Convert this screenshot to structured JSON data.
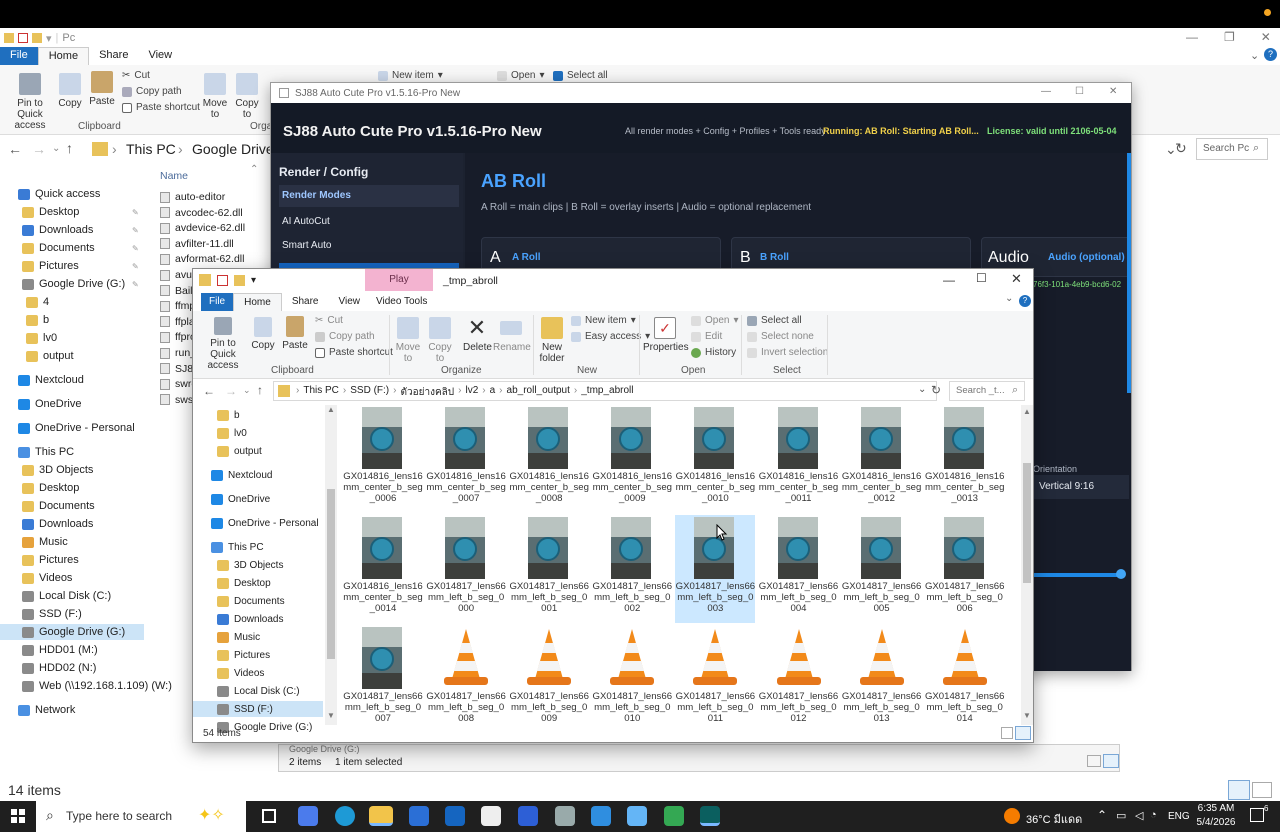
{
  "back_window": {
    "title": "Pc",
    "tabs": [
      "File",
      "Home",
      "Share",
      "View"
    ],
    "clipboard": {
      "pin": "Pin to Quick access",
      "copy": "Copy",
      "paste": "Paste",
      "cut": "Cut",
      "copy_path": "Copy path",
      "paste_shortcut": "Paste shortcut",
      "group": "Clipboard"
    },
    "organize": {
      "move": "Move to",
      "copy": "Copy to",
      "group": "Orga"
    },
    "new_item": "New item",
    "open": "Open",
    "select_all": "Select all",
    "breadcrumb": [
      "This PC",
      "Google Drive"
    ],
    "search_placeholder": "Search Pc",
    "column_name": "Name",
    "nav": [
      {
        "label": "Quick access",
        "icon": "star-icon"
      },
      {
        "label": "Desktop",
        "icon": "folder-icon",
        "pin": true
      },
      {
        "label": "Downloads",
        "icon": "download-icon",
        "pin": true
      },
      {
        "label": "Documents",
        "icon": "folder-icon",
        "pin": true
      },
      {
        "label": "Pictures",
        "icon": "folder-icon",
        "pin": true
      },
      {
        "label": "Google Drive (G:)",
        "icon": "drive-icon",
        "pin": true
      },
      {
        "label": "4",
        "icon": "folder-icon"
      },
      {
        "label": "b",
        "icon": "folder-icon"
      },
      {
        "label": "lv0",
        "icon": "folder-icon"
      },
      {
        "label": "output",
        "icon": "folder-icon"
      },
      {
        "label": "Nextcloud",
        "icon": "cloud-icon"
      },
      {
        "label": "OneDrive",
        "icon": "cloud-icon"
      },
      {
        "label": "OneDrive - Personal",
        "icon": "cloud-icon"
      },
      {
        "label": "This PC",
        "icon": "pc-icon"
      },
      {
        "label": "3D Objects",
        "icon": "folder-icon"
      },
      {
        "label": "Desktop",
        "icon": "folder-icon"
      },
      {
        "label": "Documents",
        "icon": "folder-icon"
      },
      {
        "label": "Downloads",
        "icon": "download-icon"
      },
      {
        "label": "Music",
        "icon": "music-icon"
      },
      {
        "label": "Pictures",
        "icon": "folder-icon"
      },
      {
        "label": "Videos",
        "icon": "folder-icon"
      },
      {
        "label": "Local Disk (C:)",
        "icon": "drive-icon"
      },
      {
        "label": "SSD (F:)",
        "icon": "drive-icon"
      },
      {
        "label": "Google Drive (G:)",
        "icon": "drive-icon",
        "selected": true
      },
      {
        "label": "HDD01 (M:)",
        "icon": "drive-icon"
      },
      {
        "label": "HDD02 (N:)",
        "icon": "drive-icon"
      },
      {
        "label": "Web (\\\\192.168.1.109) (W:)",
        "icon": "drive-icon"
      },
      {
        "label": "Network",
        "icon": "network-icon"
      }
    ],
    "files": [
      "auto-editor",
      "avcodec-62.dll",
      "avdevice-62.dll",
      "avfilter-11.dll",
      "avformat-62.dll",
      "avut",
      "Bail",
      "ffmp",
      "ffpla",
      "ffpro",
      "run_",
      "SJ88",
      "swre",
      "swsc"
    ],
    "status": "14 items"
  },
  "app": {
    "window_title": "SJ88 Auto Cute Pro v1.5.16-Pro New",
    "header_title": "SJ88 Auto Cute Pro v1.5.16-Pro New",
    "header_info": "All render modes + Config + Profiles + Tools ready",
    "header_running": "Running: AB Roll: Starting AB Roll...",
    "header_license": "License: valid until 2106-05-04",
    "side_title": "Render / Config",
    "side_items": [
      "Render Modes",
      "AI AutoCut",
      "Smart Auto"
    ],
    "main_title": "AB Roll",
    "main_subtitle": "A Roll = main clips | B Roll = overlay inserts | Audio = optional replacement",
    "card_a_letter": "A",
    "card_a_label": "A Roll",
    "card_b_letter": "B",
    "card_b_label": "B Roll",
    "card_audio_letter": "Audio",
    "card_audio_label": "Audio (optional)",
    "card_audio_id": "76f3-101a-4eb9-bcd6-02",
    "orientation_label": "Orientation",
    "orientation_value": "Vertical 9:16",
    "status_left": "2 items",
    "status_sel": "1 item selected",
    "nav_partial": "Google Drive (G:)",
    "slider_fraction": 1.0
  },
  "front_window": {
    "context_tab": "Play",
    "title": "_tmp_abroll",
    "tabs": [
      "File",
      "Home",
      "Share",
      "View",
      "Video Tools"
    ],
    "clipboard": {
      "pin": "Pin to Quick access",
      "copy": "Copy",
      "paste": "Paste",
      "cut": "Cut",
      "copy_path": "Copy path",
      "paste_shortcut": "Paste shortcut",
      "group": "Clipboard"
    },
    "organize": {
      "move": "Move to",
      "copy": "Copy to",
      "delete": "Delete",
      "rename": "Rename",
      "group": "Organize"
    },
    "new": {
      "new_folder": "New folder",
      "new_item": "New item",
      "easy_access": "Easy access",
      "group": "New"
    },
    "open": {
      "properties": "Properties",
      "open": "Open",
      "edit": "Edit",
      "history": "History",
      "group": "Open"
    },
    "select": {
      "select_all": "Select all",
      "select_none": "Select none",
      "invert": "Invert selection",
      "group": "Select"
    },
    "breadcrumb": [
      "This PC",
      "SSD (F:)",
      "ตัวอย่างคลิป",
      "lv2",
      "a",
      "ab_roll_output",
      "_tmp_abroll"
    ],
    "search_placeholder": "Search _t...",
    "tree": [
      {
        "label": "b",
        "icon": "folder-icon"
      },
      {
        "label": "lv0",
        "icon": "folder-icon"
      },
      {
        "label": "output",
        "icon": "folder-icon"
      },
      {
        "label": "Nextcloud",
        "icon": "cloud-icon"
      },
      {
        "label": "OneDrive",
        "icon": "cloud-icon"
      },
      {
        "label": "OneDrive - Personal",
        "icon": "cloud-icon"
      },
      {
        "label": "This PC",
        "icon": "pc-icon"
      },
      {
        "label": "3D Objects",
        "icon": "folder-icon"
      },
      {
        "label": "Desktop",
        "icon": "folder-icon"
      },
      {
        "label": "Documents",
        "icon": "folder-icon"
      },
      {
        "label": "Downloads",
        "icon": "download-icon"
      },
      {
        "label": "Music",
        "icon": "music-icon"
      },
      {
        "label": "Pictures",
        "icon": "folder-icon"
      },
      {
        "label": "Videos",
        "icon": "folder-icon"
      },
      {
        "label": "Local Disk (C:)",
        "icon": "drive-icon"
      },
      {
        "label": "SSD (F:)",
        "icon": "drive-icon",
        "selected": true
      },
      {
        "label": "Google Drive (G:)",
        "icon": "drive-icon"
      }
    ],
    "files": [
      {
        "name": "GX014816_lens16mm_center_b_seg_0006",
        "kind": "thumb"
      },
      {
        "name": "GX014816_lens16mm_center_b_seg_0007",
        "kind": "thumb"
      },
      {
        "name": "GX014816_lens16mm_center_b_seg_0008",
        "kind": "thumb"
      },
      {
        "name": "GX014816_lens16mm_center_b_seg_0009",
        "kind": "thumb"
      },
      {
        "name": "GX014816_lens16mm_center_b_seg_0010",
        "kind": "thumb"
      },
      {
        "name": "GX014816_lens16mm_center_b_seg_0011",
        "kind": "thumb"
      },
      {
        "name": "GX014816_lens16mm_center_b_seg_0012",
        "kind": "thumb"
      },
      {
        "name": "GX014816_lens16mm_center_b_seg_0013",
        "kind": "thumb"
      },
      {
        "name": "GX014816_lens16mm_center_b_seg_0014",
        "kind": "thumb"
      },
      {
        "name": "GX014817_lens66mm_left_b_seg_0000",
        "kind": "thumb"
      },
      {
        "name": "GX014817_lens66mm_left_b_seg_0001",
        "kind": "thumb"
      },
      {
        "name": "GX014817_lens66mm_left_b_seg_0002",
        "kind": "thumb"
      },
      {
        "name": "GX014817_lens66mm_left_b_seg_0003",
        "kind": "thumb",
        "selected": true
      },
      {
        "name": "GX014817_lens66mm_left_b_seg_0004",
        "kind": "thumb"
      },
      {
        "name": "GX014817_lens66mm_left_b_seg_0005",
        "kind": "thumb"
      },
      {
        "name": "GX014817_lens66mm_left_b_seg_0006",
        "kind": "thumb"
      },
      {
        "name": "GX014817_lens66mm_left_b_seg_0007",
        "kind": "thumb"
      },
      {
        "name": "GX014817_lens66mm_left_b_seg_0008",
        "kind": "vlc"
      },
      {
        "name": "GX014817_lens66mm_left_b_seg_0009",
        "kind": "vlc"
      },
      {
        "name": "GX014817_lens66mm_left_b_seg_0010",
        "kind": "vlc"
      },
      {
        "name": "GX014817_lens66mm_left_b_seg_0011",
        "kind": "vlc"
      },
      {
        "name": "GX014817_lens66mm_left_b_seg_0012",
        "kind": "vlc"
      },
      {
        "name": "GX014817_lens66mm_left_b_seg_0013",
        "kind": "vlc"
      },
      {
        "name": "GX014817_lens66mm_left_b_seg_0014",
        "kind": "vlc"
      }
    ],
    "status": "54 items"
  },
  "taskbar": {
    "search_placeholder": "Type here to search",
    "weather": "36°C มีแดด",
    "lang": "ENG",
    "time": "6:35 AM",
    "date": "5/4/2026",
    "notifications": "6"
  },
  "colors": {
    "accent": "#1f6fbf",
    "app_bg": "#171c29",
    "app_title": "#f2f2f2",
    "running": "#f0d04a",
    "license": "#7ee07a",
    "app_link": "#4aa3ff",
    "play_tab": "#f3b3d0"
  }
}
